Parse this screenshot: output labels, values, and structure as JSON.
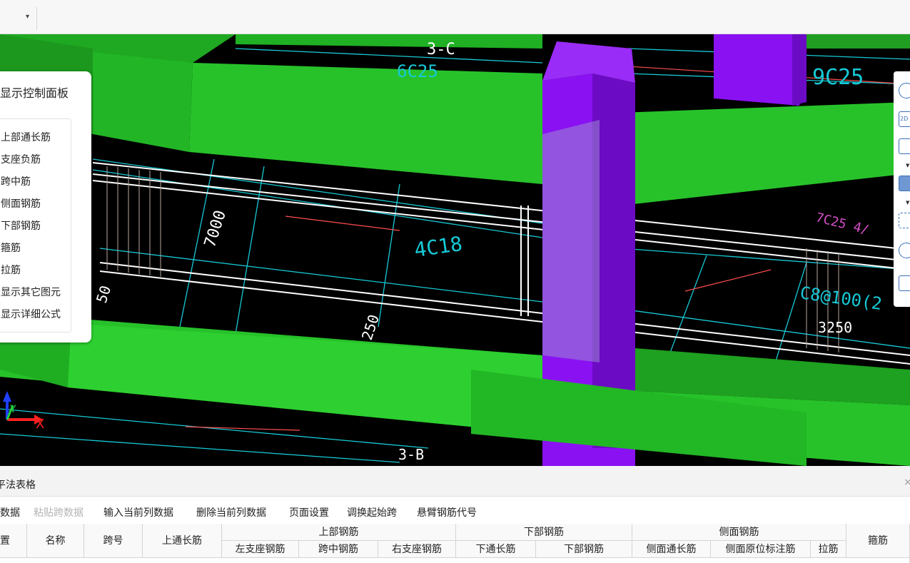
{
  "top_toolbar": {
    "dropdown_arrow": "▾"
  },
  "viewport": {
    "control_panel": {
      "title": "显示控制面板",
      "items": [
        "上部通长筋",
        "支座负筋",
        "跨中筋",
        "侧面钢筋",
        "下部钢筋",
        "箍筋",
        "拉筋",
        "显示其它图元",
        "显示详细公式"
      ]
    },
    "labels": {
      "axis_top": "3-C",
      "axis_bottom": "3-B",
      "rebar_6c25": "6C25",
      "rebar_9c25": "9C25",
      "rebar_7c25": "7C25 4/",
      "rebar_4c18": "4C18",
      "rebar_c8": "C8@100(2",
      "dim_7000": "7000",
      "dim_3250": "3250",
      "dim_50": "50",
      "dim_250": "250",
      "axis_x": "X",
      "axis_y": "Y"
    },
    "right_toolbar": {
      "btn_2d": "2D"
    },
    "collapse_handle": "⌄"
  },
  "colors": {
    "beam_green": "#27c22a",
    "column_purple": "#8a12f2",
    "grid_cyan": "#17c9d6",
    "dim_red": "#ff4e4e",
    "rebar_label_pink": "#d64fc8",
    "background": "#000000",
    "accent_blue": "#3a70b8"
  },
  "bottom_panel": {
    "title": "平法表格",
    "close": "×",
    "toolbar": [
      {
        "label": "数据",
        "enabled": true
      },
      {
        "label": "粘贴跨数据",
        "enabled": false
      },
      {
        "label": "输入当前列数据",
        "enabled": true
      },
      {
        "label": "删除当前列数据",
        "enabled": true
      },
      {
        "label": "页面设置",
        "enabled": true
      },
      {
        "label": "调换起始跨",
        "enabled": true
      },
      {
        "label": "悬臂钢筋代号",
        "enabled": true
      }
    ],
    "table": {
      "col_position": "置",
      "col_name": "名称",
      "col_span": "跨号",
      "col_top_continuous": "上通长筋",
      "group_top": "上部钢筋",
      "top_left_support": "左支座钢筋",
      "top_mid": "跨中钢筋",
      "top_right_support": "右支座钢筋",
      "group_bottom": "下部钢筋",
      "bottom_continuous": "下通长筋",
      "bottom_rebar": "下部钢筋",
      "group_side": "侧面钢筋",
      "side_continuous": "侧面通长筋",
      "side_in_situ": "侧面原位标注筋",
      "side_tie": "拉筋",
      "col_stirrup": "箍筋"
    }
  }
}
